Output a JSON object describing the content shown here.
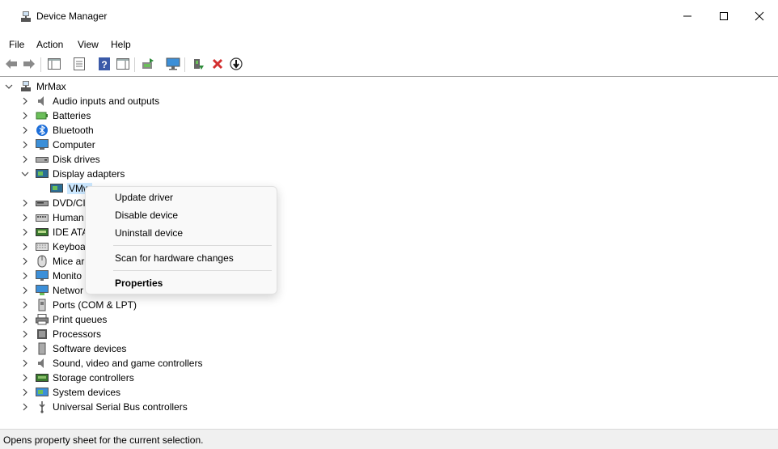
{
  "window": {
    "title": "Device Manager",
    "minimize_glyph": "─",
    "maximize_glyph": "☐",
    "close_glyph": "✕"
  },
  "menu": [
    "File",
    "Action",
    "View",
    "Help"
  ],
  "toolbar": {
    "buttons": [
      "back-icon",
      "forward-icon",
      "show-hide-console-tree-icon",
      "properties-icon",
      "help-icon",
      "action-pane-icon",
      "update-driver-icon",
      "scan-hardware-icon",
      "enable-device-icon",
      "uninstall-icon",
      "disable-icon"
    ]
  },
  "tree": {
    "root": "MrMax",
    "categories": [
      {
        "label": "Audio inputs and outputs",
        "icon": "speaker-icon"
      },
      {
        "label": "Batteries",
        "icon": "battery-icon"
      },
      {
        "label": "Bluetooth",
        "icon": "bluetooth-icon"
      },
      {
        "label": "Computer",
        "icon": "computer-icon"
      },
      {
        "label": "Disk drives",
        "icon": "disk-drive-icon"
      },
      {
        "label": "Display adapters",
        "icon": "display-adapter-icon",
        "expanded": true
      },
      {
        "label": "DVD/CI",
        "icon": "dvd-drive-icon"
      },
      {
        "label": "Human",
        "icon": "hid-icon"
      },
      {
        "label": "IDE ATA",
        "icon": "ide-icon"
      },
      {
        "label": "Keyboa",
        "icon": "keyboard-icon"
      },
      {
        "label": "Mice ar",
        "icon": "mouse-icon"
      },
      {
        "label": "Monito",
        "icon": "monitor-icon"
      },
      {
        "label": "Networ",
        "icon": "network-icon"
      },
      {
        "label": "Ports (COM & LPT)",
        "icon": "port-icon"
      },
      {
        "label": "Print queues",
        "icon": "printer-icon"
      },
      {
        "label": "Processors",
        "icon": "processor-icon"
      },
      {
        "label": "Software devices",
        "icon": "software-device-icon"
      },
      {
        "label": "Sound, video and game controllers",
        "icon": "sound-icon"
      },
      {
        "label": "Storage controllers",
        "icon": "storage-controller-icon"
      },
      {
        "label": "System devices",
        "icon": "system-device-icon"
      },
      {
        "label": "Universal Serial Bus controllers",
        "icon": "usb-icon"
      }
    ],
    "child_device": "VMw"
  },
  "context_menu": {
    "items": [
      "Update driver",
      "Disable device",
      "Uninstall device",
      "Scan for hardware changes",
      "Properties"
    ]
  },
  "status": {
    "text": "Opens property sheet for the current selection."
  },
  "colors": {
    "selection": "#cce8ff",
    "monitor_blue": "#3c8fd8",
    "uninstall_red": "#d32f2f"
  }
}
